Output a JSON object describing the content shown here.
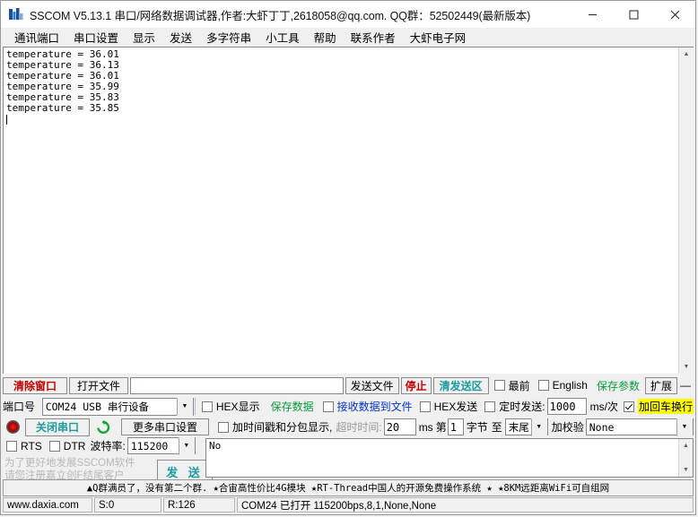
{
  "window": {
    "title": "SSCOM V5.13.1 串口/网络数据调试器,作者:大虾丁丁,2618058@qq.com. QQ群：52502449(最新版本)",
    "minimize": "—",
    "maximize": "□",
    "close": "✕"
  },
  "menubar": {
    "items": [
      {
        "label": "通讯端口"
      },
      {
        "label": "串口设置"
      },
      {
        "label": "显示"
      },
      {
        "label": "发送"
      },
      {
        "label": "多字符串"
      },
      {
        "label": "小工具"
      },
      {
        "label": "帮助"
      },
      {
        "label": "联系作者"
      },
      {
        "label": "大虾电子网"
      }
    ]
  },
  "terminal": {
    "lines": [
      "temperature = 36.01",
      "temperature = 36.13",
      "temperature = 36.01",
      "temperature = 35.99",
      "temperature = 35.83",
      "temperature = 35.85"
    ],
    "text": "temperature = 36.01\ntemperature = 36.13\ntemperature = 36.01\ntemperature = 35.99\ntemperature = 35.83\ntemperature = 35.85",
    "scroll_up": "▲",
    "scroll_down": "▼"
  },
  "toolbar": {
    "clear_window": "清除窗口",
    "open_file": "打开文件",
    "file_path": "",
    "file_path_placeholder": "",
    "send_file": "发送文件",
    "stop": "停止",
    "clear_send": "清发送区",
    "topmost_label": "最前",
    "topmost_checked": false,
    "english_label": "English",
    "english_checked": false,
    "save_params": "保存参数",
    "extend": "扩展",
    "minus": "—"
  },
  "port": {
    "port_label": "端口号",
    "port_value": "COM24 USB 串行设备",
    "close_port_button": "关闭串口",
    "more_settings": "更多串口设置",
    "baud_label": "波特率:",
    "baud_value": "115200",
    "rts_label": "RTS",
    "rts_checked": false,
    "dtr_label": "DTR",
    "dtr_checked": false
  },
  "receive": {
    "hex_display_label": "HEX显示",
    "hex_display_checked": false,
    "save_data": "保存数据",
    "recv_to_file_label": "接收数据到文件",
    "recv_to_file_checked": false,
    "timestamp_label": "加时间戳和分包显示,",
    "timestamp_checked": false,
    "timeout_label": "超时时间:",
    "timeout_value": "20",
    "timeout_unit": "ms",
    "byte_prefix": "第",
    "byte_index": "1",
    "byte_label": "字节",
    "to_label": "至",
    "to_value": "末尾",
    "checksum_label": "加校验",
    "checksum_value": "None"
  },
  "send": {
    "hex_send_label": "HEX发送",
    "hex_send_checked": false,
    "timed_send_label": "定时发送:",
    "timed_send_checked": false,
    "interval_value": "1000",
    "interval_unit": "ms/次",
    "crlf_label": "加回车换行",
    "crlf_checked": true,
    "help_marker": "?",
    "send_text": "No",
    "send_button": "发 送",
    "registration_line1": "为了更好地发展SSCOM软件",
    "registration_line2": "请您注册嘉立创F结尾客户"
  },
  "adbar": {
    "text": "▲Q群满员了，没有第二个群. ★合宙高性价比4G模块 ★RT-Thread中国人的开源免费操作系统 ★ ★8KM远距离WiFi可自组网"
  },
  "statusbar": {
    "website": "www.daxia.com",
    "sent": "S:0",
    "received": "R:126",
    "connection": "COM24 已打开  115200bps,8,1,None,None"
  },
  "colors": {
    "accent_red": "#c00000",
    "accent_green": "#0a9a3c",
    "accent_teal": "#1b9aa0",
    "accent_blue": "#0033cc",
    "highlight_yellow": "#ffff00",
    "window_bg": "#f0f0f0",
    "terminal_bg": "#ffffff"
  }
}
